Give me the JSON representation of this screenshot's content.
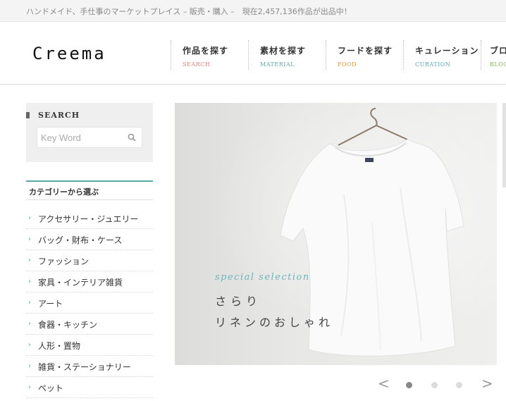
{
  "topbar": {
    "tagline": "ハンドメイド、手仕事のマーケットプレイス – 販売・購入 –　現在2,457,136作品が出品中！"
  },
  "header": {
    "logo": "Creema",
    "nav": [
      {
        "label": "作品を探す",
        "sub": "SEARCH",
        "color": "#e8837d"
      },
      {
        "label": "素材を探す",
        "sub": "MATERIAL",
        "color": "#5aa9a9"
      },
      {
        "label": "フードを探す",
        "sub": "FOOD",
        "color": "#e8953a"
      },
      {
        "label": "キュレーション",
        "sub": "CURATION",
        "color": "#5aa9c0"
      },
      {
        "label": "ブロ",
        "sub": "BLOG",
        "color": "#8bb35a"
      }
    ]
  },
  "sidebar": {
    "search_title": "SEARCH",
    "search_placeholder": "Key Word",
    "category_title": "カテゴリーから選ぶ",
    "categories": [
      "アクセサリー・ジュエリー",
      "バッグ・財布・ケース",
      "ファッション",
      "家具・インテリア雑貨",
      "アート",
      "食器・キッチン",
      "人形・置物",
      "雑貨・ステーショナリー",
      "ペット"
    ]
  },
  "hero": {
    "subtitle": "special selection",
    "line1": "さらり",
    "line2": "リネンのおしゃれ"
  },
  "pager": {
    "prev": "<",
    "next": ">",
    "active_index": 0,
    "count": 3
  },
  "colors": {
    "accent": "#5aa9a9"
  }
}
